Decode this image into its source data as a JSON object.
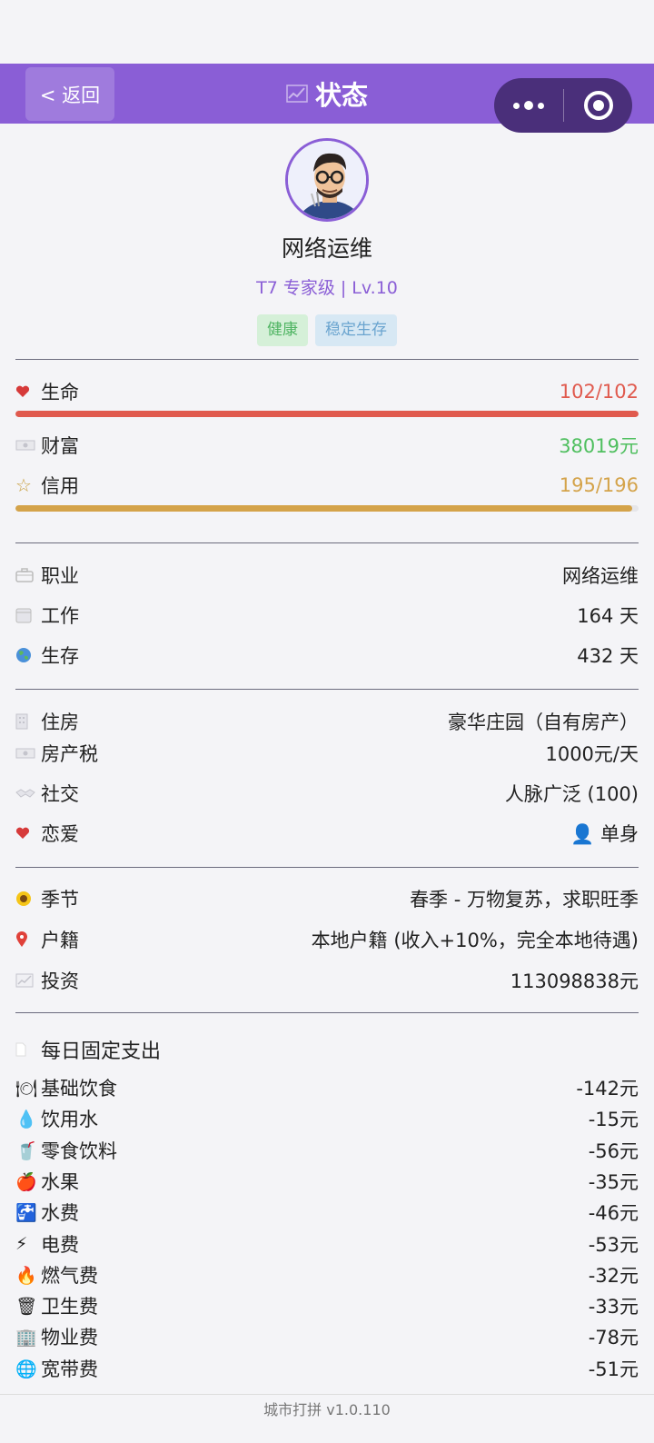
{
  "navbar": {
    "back_label": "< 返回",
    "title": "状态"
  },
  "profile": {
    "name": "网络运维",
    "level": "T7 专家级 | Lv.10",
    "tags": [
      "健康",
      "稳定生存"
    ]
  },
  "stats": {
    "life": {
      "label": "生命",
      "value": "102/102",
      "fill_fraction": 1.0,
      "color": "#e05a4e"
    },
    "wealth": {
      "label": "财富",
      "value": "38019元",
      "color": "#4fbf5f"
    },
    "credit": {
      "label": "信用",
      "value": "195/196",
      "fill_fraction": 0.99,
      "color": "#d4a34a"
    }
  },
  "career": [
    {
      "icon": "briefcase-icon",
      "label": "职业",
      "value": "网络运维"
    },
    {
      "icon": "calendar-icon",
      "label": "工作",
      "value": "164 天"
    },
    {
      "icon": "globe-icon",
      "label": "生存",
      "value": "432 天"
    }
  ],
  "life_info": [
    {
      "icon": "building-icon",
      "label": "住房",
      "value": "豪华庄园（自有房产）"
    },
    {
      "icon": "money-icon",
      "label": "房产税",
      "value": "1000元/天"
    },
    {
      "icon": "handshake-icon",
      "label": "社交",
      "value": "人脉广泛 (100)"
    },
    {
      "icon": "heart-icon",
      "label": "恋爱",
      "value": "👤 单身"
    }
  ],
  "environment": [
    {
      "icon": "sunflower-icon",
      "label": "季节",
      "value": "春季 - 万物复苏，求职旺季"
    },
    {
      "icon": "pin-icon",
      "label": "户籍",
      "value": "本地户籍 (收入+10%，完全本地待遇)"
    },
    {
      "icon": "chart-icon",
      "label": "投资",
      "value": "113098838元"
    }
  ],
  "expenses": {
    "title": "每日固定支出",
    "items": [
      {
        "icon": "food-icon",
        "glyph": "🍽",
        "label": "基础饮食",
        "value": "-142元"
      },
      {
        "icon": "water-drop-icon",
        "glyph": "💧",
        "label": "饮用水",
        "value": "-15元"
      },
      {
        "icon": "drink-icon",
        "glyph": "🥤",
        "label": "零食饮料",
        "value": "-56元"
      },
      {
        "icon": "apple-icon",
        "glyph": "🍎",
        "label": "水果",
        "value": "-35元"
      },
      {
        "icon": "faucet-icon",
        "glyph": "🚰",
        "label": "水费",
        "value": "-46元"
      },
      {
        "icon": "lightning-icon",
        "glyph": "⚡",
        "label": "电费",
        "value": "-53元"
      },
      {
        "icon": "fire-icon",
        "glyph": "🔥",
        "label": "燃气费",
        "value": "-32元"
      },
      {
        "icon": "trash-icon",
        "glyph": "🗑",
        "label": "卫生费",
        "value": "-33元"
      },
      {
        "icon": "building-icon",
        "glyph": "🏢",
        "label": "物业费",
        "value": "-78元"
      },
      {
        "icon": "globe-icon",
        "glyph": "🌐",
        "label": "宽带费",
        "value": "-51元"
      }
    ]
  },
  "footer": {
    "text": "城市打拼 v1.0.110"
  }
}
